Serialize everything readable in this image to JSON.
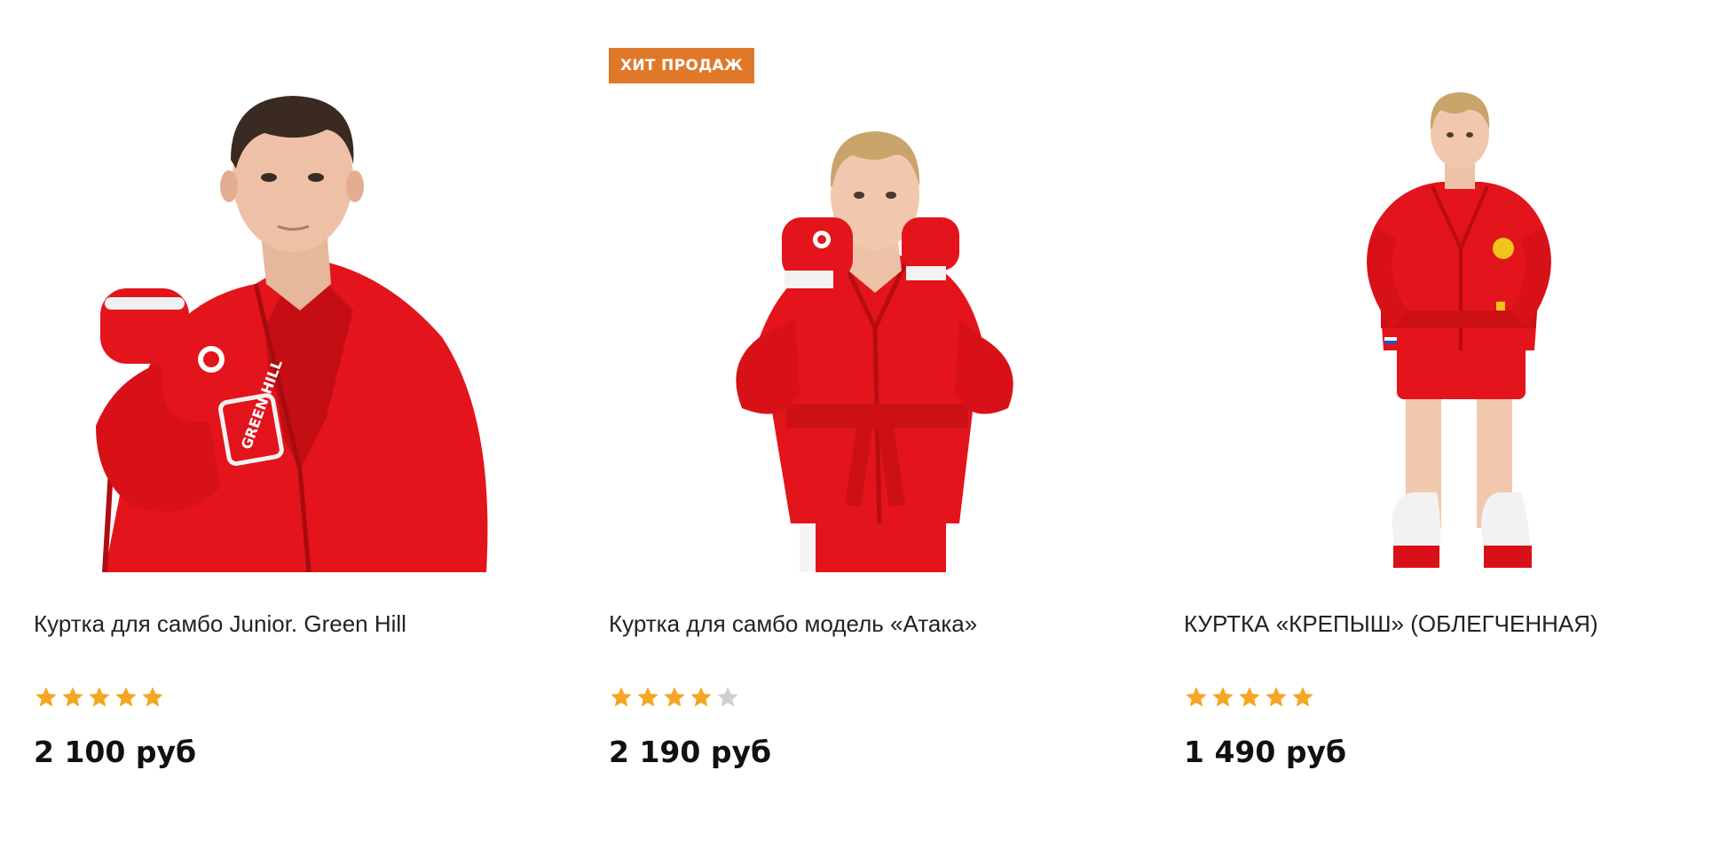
{
  "colors": {
    "star_filled": "#f5a623",
    "star_empty": "#cfcfcf",
    "badge": "#e0782a",
    "uniform_red": "#e3141b"
  },
  "products": [
    {
      "title": "Куртка для самбо Junior. Green Hill",
      "rating": 5,
      "rating_max": 5,
      "price": "2 100 руб",
      "badge": "",
      "glove_text": "GREEN HILL"
    },
    {
      "title": "Куртка для самбо модель «Атака»",
      "rating": 4,
      "rating_max": 5,
      "price": "2 190 руб",
      "badge": "ХИТ ПРОДАЖ"
    },
    {
      "title": "КУРТКА «КРЕПЫШ» (ОБЛЕГЧЕННАЯ)",
      "rating": 5,
      "rating_max": 5,
      "price": "1 490 руб",
      "badge": ""
    }
  ]
}
